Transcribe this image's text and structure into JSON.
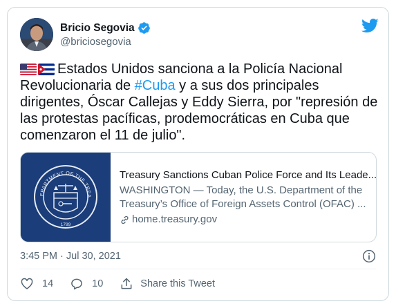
{
  "author": {
    "display_name": "Bricio Segovia",
    "handle": "@briciosegovia",
    "verified": true
  },
  "tweet": {
    "text_before_hashtag": "Estados Unidos sanciona a la Policía Nacional Revolucionaria de ",
    "hashtag": "#Cuba",
    "text_after_hashtag": " y a sus dos principales dirigentes, Óscar Callejas y Eddy Sierra, por \"represión de las protestas pacíficas, prodemocráticas en Cuba que comenzaron el 11 de julio\".",
    "flag_icons": [
      "us-flag-icon",
      "cuba-flag-icon"
    ]
  },
  "link_card": {
    "title": "Treasury Sanctions Cuban Police Force and Its Leade...",
    "description": "WASHINGTON — Today, the U.S. Department of the Treasury’s Office of Foreign Assets Control (OFAC) ...",
    "domain": "home.treasury.gov",
    "thumbnail": {
      "seal_text_top": "THE DEPARTMENT OF THE TREASURY",
      "seal_year": "1789"
    }
  },
  "timestamp": "3:45 PM · Jul 30, 2021",
  "actions": {
    "likes": "14",
    "replies": "10",
    "share_label": "Share this Tweet"
  },
  "colors": {
    "accent": "#1d9bf0",
    "text": "#0f1419",
    "secondary": "#536471",
    "border": "#cfd9de"
  }
}
